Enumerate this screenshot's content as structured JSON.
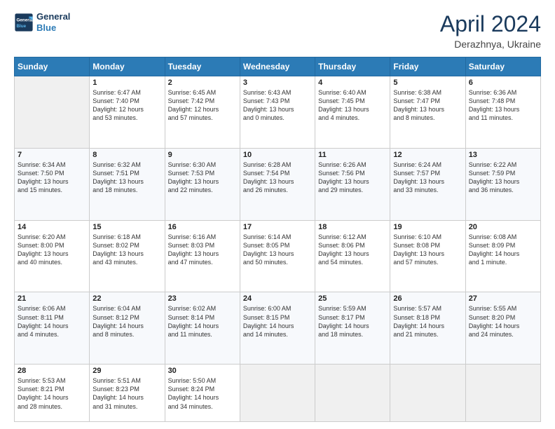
{
  "header": {
    "logo_line1": "General",
    "logo_line2": "Blue",
    "month": "April 2024",
    "location": "Derazhnya, Ukraine"
  },
  "weekdays": [
    "Sunday",
    "Monday",
    "Tuesday",
    "Wednesday",
    "Thursday",
    "Friday",
    "Saturday"
  ],
  "rows": [
    [
      {
        "day": "",
        "info": ""
      },
      {
        "day": "1",
        "info": "Sunrise: 6:47 AM\nSunset: 7:40 PM\nDaylight: 12 hours\nand 53 minutes."
      },
      {
        "day": "2",
        "info": "Sunrise: 6:45 AM\nSunset: 7:42 PM\nDaylight: 12 hours\nand 57 minutes."
      },
      {
        "day": "3",
        "info": "Sunrise: 6:43 AM\nSunset: 7:43 PM\nDaylight: 13 hours\nand 0 minutes."
      },
      {
        "day": "4",
        "info": "Sunrise: 6:40 AM\nSunset: 7:45 PM\nDaylight: 13 hours\nand 4 minutes."
      },
      {
        "day": "5",
        "info": "Sunrise: 6:38 AM\nSunset: 7:47 PM\nDaylight: 13 hours\nand 8 minutes."
      },
      {
        "day": "6",
        "info": "Sunrise: 6:36 AM\nSunset: 7:48 PM\nDaylight: 13 hours\nand 11 minutes."
      }
    ],
    [
      {
        "day": "7",
        "info": "Sunrise: 6:34 AM\nSunset: 7:50 PM\nDaylight: 13 hours\nand 15 minutes."
      },
      {
        "day": "8",
        "info": "Sunrise: 6:32 AM\nSunset: 7:51 PM\nDaylight: 13 hours\nand 18 minutes."
      },
      {
        "day": "9",
        "info": "Sunrise: 6:30 AM\nSunset: 7:53 PM\nDaylight: 13 hours\nand 22 minutes."
      },
      {
        "day": "10",
        "info": "Sunrise: 6:28 AM\nSunset: 7:54 PM\nDaylight: 13 hours\nand 26 minutes."
      },
      {
        "day": "11",
        "info": "Sunrise: 6:26 AM\nSunset: 7:56 PM\nDaylight: 13 hours\nand 29 minutes."
      },
      {
        "day": "12",
        "info": "Sunrise: 6:24 AM\nSunset: 7:57 PM\nDaylight: 13 hours\nand 33 minutes."
      },
      {
        "day": "13",
        "info": "Sunrise: 6:22 AM\nSunset: 7:59 PM\nDaylight: 13 hours\nand 36 minutes."
      }
    ],
    [
      {
        "day": "14",
        "info": "Sunrise: 6:20 AM\nSunset: 8:00 PM\nDaylight: 13 hours\nand 40 minutes."
      },
      {
        "day": "15",
        "info": "Sunrise: 6:18 AM\nSunset: 8:02 PM\nDaylight: 13 hours\nand 43 minutes."
      },
      {
        "day": "16",
        "info": "Sunrise: 6:16 AM\nSunset: 8:03 PM\nDaylight: 13 hours\nand 47 minutes."
      },
      {
        "day": "17",
        "info": "Sunrise: 6:14 AM\nSunset: 8:05 PM\nDaylight: 13 hours\nand 50 minutes."
      },
      {
        "day": "18",
        "info": "Sunrise: 6:12 AM\nSunset: 8:06 PM\nDaylight: 13 hours\nand 54 minutes."
      },
      {
        "day": "19",
        "info": "Sunrise: 6:10 AM\nSunset: 8:08 PM\nDaylight: 13 hours\nand 57 minutes."
      },
      {
        "day": "20",
        "info": "Sunrise: 6:08 AM\nSunset: 8:09 PM\nDaylight: 14 hours\nand 1 minute."
      }
    ],
    [
      {
        "day": "21",
        "info": "Sunrise: 6:06 AM\nSunset: 8:11 PM\nDaylight: 14 hours\nand 4 minutes."
      },
      {
        "day": "22",
        "info": "Sunrise: 6:04 AM\nSunset: 8:12 PM\nDaylight: 14 hours\nand 8 minutes."
      },
      {
        "day": "23",
        "info": "Sunrise: 6:02 AM\nSunset: 8:14 PM\nDaylight: 14 hours\nand 11 minutes."
      },
      {
        "day": "24",
        "info": "Sunrise: 6:00 AM\nSunset: 8:15 PM\nDaylight: 14 hours\nand 14 minutes."
      },
      {
        "day": "25",
        "info": "Sunrise: 5:59 AM\nSunset: 8:17 PM\nDaylight: 14 hours\nand 18 minutes."
      },
      {
        "day": "26",
        "info": "Sunrise: 5:57 AM\nSunset: 8:18 PM\nDaylight: 14 hours\nand 21 minutes."
      },
      {
        "day": "27",
        "info": "Sunrise: 5:55 AM\nSunset: 8:20 PM\nDaylight: 14 hours\nand 24 minutes."
      }
    ],
    [
      {
        "day": "28",
        "info": "Sunrise: 5:53 AM\nSunset: 8:21 PM\nDaylight: 14 hours\nand 28 minutes."
      },
      {
        "day": "29",
        "info": "Sunrise: 5:51 AM\nSunset: 8:23 PM\nDaylight: 14 hours\nand 31 minutes."
      },
      {
        "day": "30",
        "info": "Sunrise: 5:50 AM\nSunset: 8:24 PM\nDaylight: 14 hours\nand 34 minutes."
      },
      {
        "day": "",
        "info": ""
      },
      {
        "day": "",
        "info": ""
      },
      {
        "day": "",
        "info": ""
      },
      {
        "day": "",
        "info": ""
      }
    ]
  ]
}
